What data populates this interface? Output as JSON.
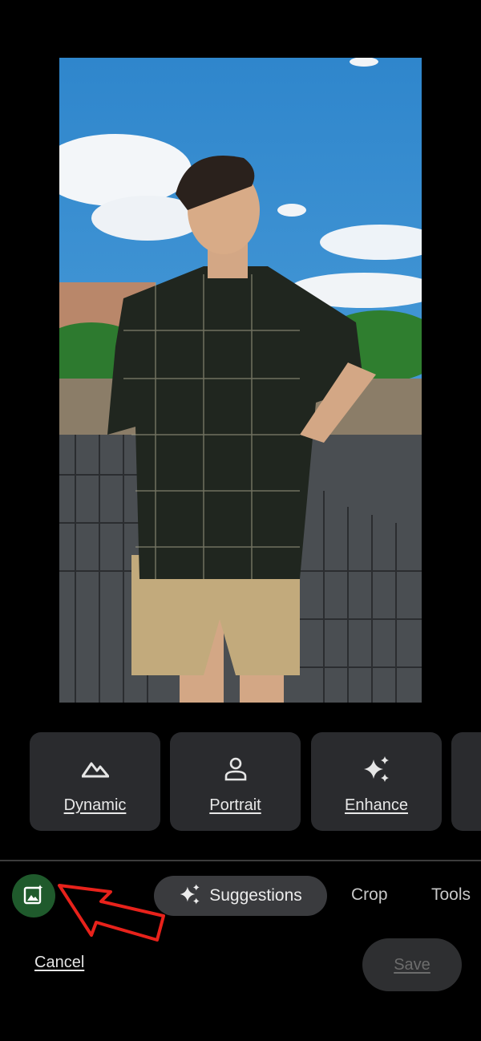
{
  "editor": {
    "photo_subject": "edit-photo",
    "suggestions": [
      {
        "label": "Dynamic",
        "icon": "mountain-icon"
      },
      {
        "label": "Portrait",
        "icon": "person-icon"
      },
      {
        "label": "Enhance",
        "icon": "sparkle-icon"
      }
    ],
    "tabs": {
      "suggestions": "Suggestions",
      "crop": "Crop",
      "tools": "Tools"
    },
    "actions": {
      "cancel": "Cancel",
      "save": "Save"
    },
    "colors": {
      "background": "#000000",
      "chip": "#2a2b2e",
      "ai_button": "#1f5a2c",
      "annotation_arrow": "#e8221b"
    }
  }
}
